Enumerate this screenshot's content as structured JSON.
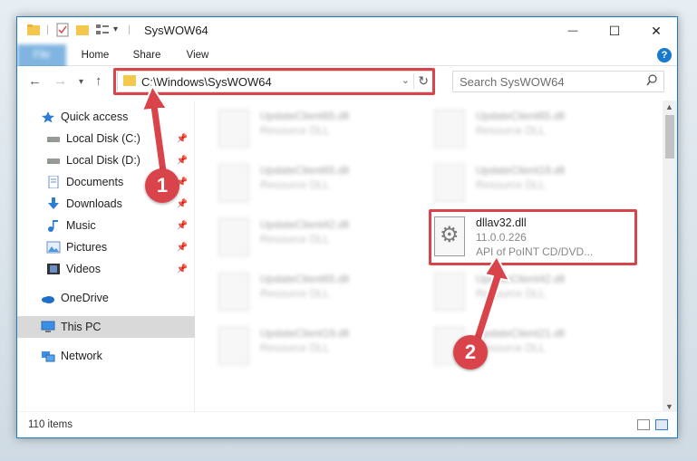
{
  "window": {
    "title": "SysWOW64",
    "quick_access_down": "▾",
    "minimize": "—",
    "maximize": "☐",
    "close": "✕"
  },
  "ribbon": {
    "tabs": [
      "File",
      "Home",
      "Share",
      "View"
    ],
    "help": "?"
  },
  "navigation": {
    "back": "←",
    "forward": "→",
    "recent": "▾",
    "up": "↑",
    "address": "C:\\Windows\\SysWOW64",
    "address_dropdown": "⌄",
    "refresh": "↻",
    "search_placeholder": "Search SysWOW64",
    "search_icon": "⚲"
  },
  "sidebar": {
    "items": [
      {
        "label": "Quick access",
        "icon": "star-icon",
        "pinned": false
      },
      {
        "label": "Local Disk (C:)",
        "icon": "drive-icon",
        "pinned": true
      },
      {
        "label": "Local Disk (D:)",
        "icon": "drive-icon",
        "pinned": true
      },
      {
        "label": "Documents",
        "icon": "documents-icon",
        "pinned": true
      },
      {
        "label": "Downloads",
        "icon": "download-icon",
        "pinned": true
      },
      {
        "label": "Music",
        "icon": "music-icon",
        "pinned": true
      },
      {
        "label": "Pictures",
        "icon": "pictures-icon",
        "pinned": true
      },
      {
        "label": "Videos",
        "icon": "videos-icon",
        "pinned": true
      },
      {
        "label": "OneDrive",
        "icon": "cloud-icon",
        "pinned": false
      },
      {
        "label": "This PC",
        "icon": "pc-icon",
        "pinned": false,
        "selected": true
      },
      {
        "label": "Network",
        "icon": "network-icon",
        "pinned": false
      }
    ],
    "pin_glyph": "📌"
  },
  "files": [
    {
      "name": "UpdateClient65.dll",
      "desc": "Resource DLL"
    },
    {
      "name": "UpdateClient65.dll",
      "desc": "Resource DLL"
    },
    {
      "name": "UpdateClient65.dll",
      "desc": "Resource DLL"
    },
    {
      "name": "UpdateClient19.dll",
      "desc": "Resource DLL"
    },
    {
      "name": "UpdateClient42.dll",
      "desc": "Resource DLL"
    },
    {
      "name": "UpdateClient65.dll",
      "desc": "Resource DLL"
    },
    {
      "name": "UpdateClient42.dll",
      "desc": "Resource DLL"
    },
    {
      "name": "UpdateClient19.dll",
      "desc": "Resource DLL"
    },
    {
      "name": "UpdateClient21.dll",
      "desc": "Resource DLL"
    }
  ],
  "highlighted_file": {
    "name": "dllav32.dll",
    "version": "11.0.0.226",
    "description": "API of PoINT CD/DVD..."
  },
  "status": {
    "item_count": "110 items"
  },
  "annotations": {
    "marker1": "1",
    "marker2": "2",
    "accent_color": "#d9434a"
  }
}
